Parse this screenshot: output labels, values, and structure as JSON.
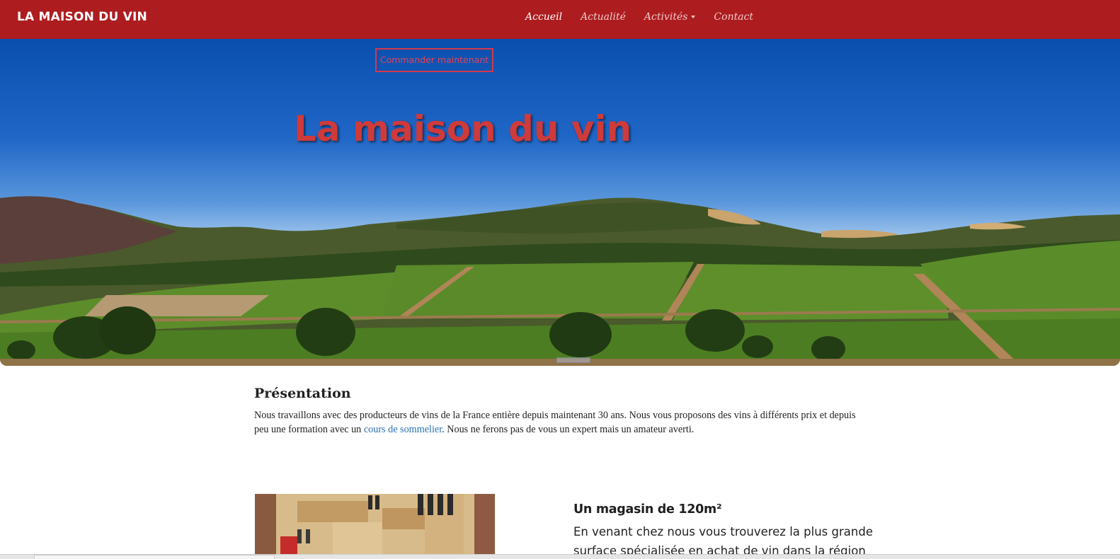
{
  "navbar": {
    "brand": "LA MAISON DU VIN",
    "links": [
      {
        "label": "Accueil",
        "active": true
      },
      {
        "label": "Actualité",
        "active": false
      },
      {
        "label": "Activités",
        "active": false,
        "dropdown": true
      },
      {
        "label": "Contact",
        "active": false
      }
    ]
  },
  "hero": {
    "order_button": "Commander maintenant",
    "title": "La maison du vin"
  },
  "presentation": {
    "title": "Présentation",
    "text_before_link": "Nous travaillons avec des producteurs de vins de la France entière depuis maintenant 30 ans. Nous vous proposons des vins à différents prix et depuis peu une formation avec un ",
    "link_text": "cours de sommelier",
    "text_after_link": ". Nous ne ferons pas de vous un expert mais un amateur averti."
  },
  "shop": {
    "title": "Un magasin de 120m²",
    "text": "En venant chez nous vous trouverez la plus grande surface spécialisée en achat de vin dans la région de"
  },
  "colors": {
    "navbar_bg": "#ad1c1f",
    "hero_title": "#cf3a3a",
    "link": "#2a6fb3"
  }
}
